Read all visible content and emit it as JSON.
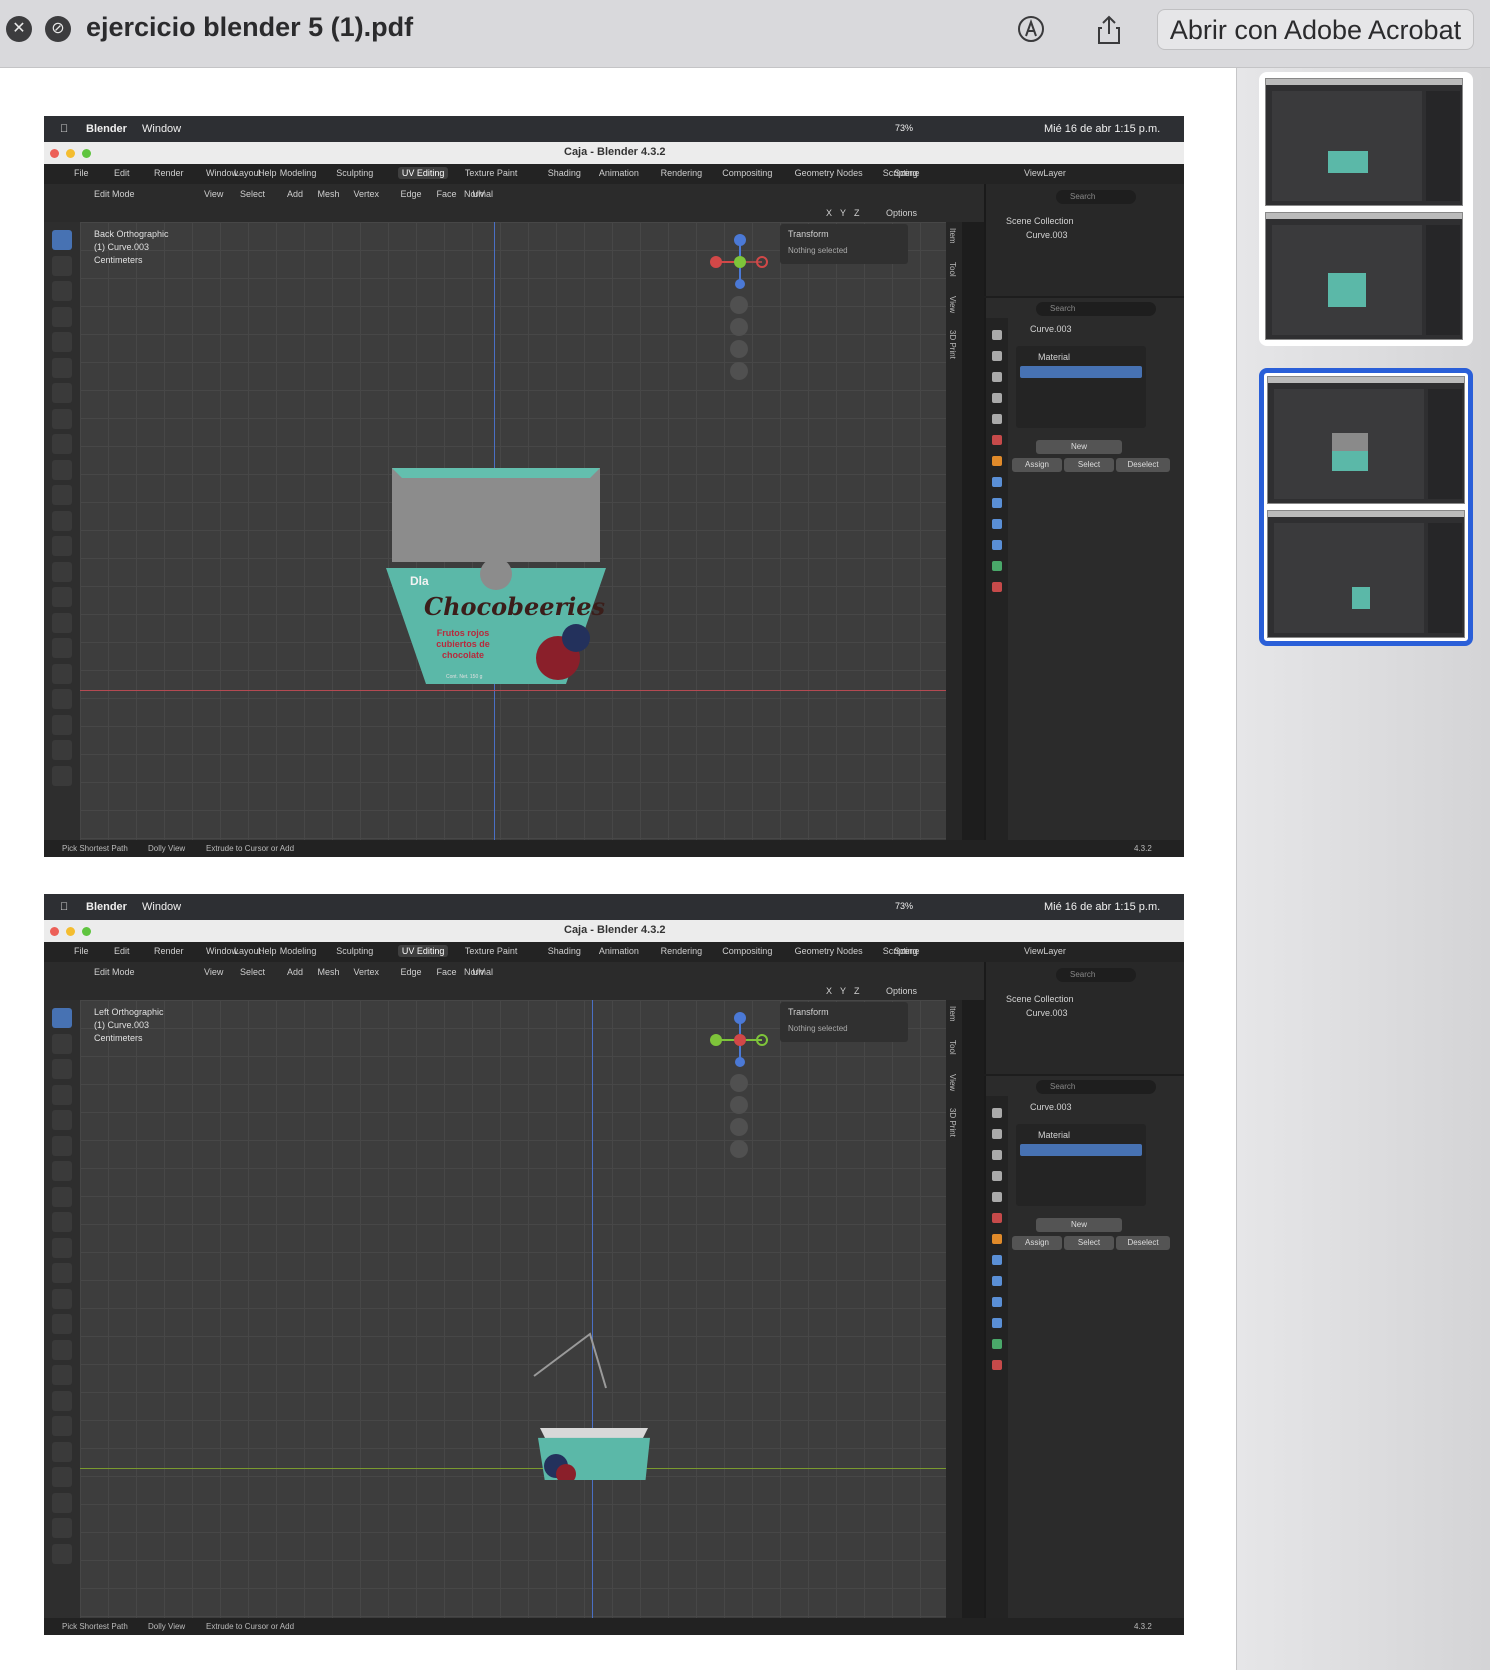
{
  "quicklook": {
    "title": "ejercicio blender 5 (1).pdf",
    "open_button": "Abrir con Adobe Acrobat",
    "close_icon": "close-icon",
    "markup_icon": "markup-icon",
    "share_icon": "share-icon"
  },
  "shots": [
    {
      "mac": {
        "app": "Blender",
        "menu": "Window",
        "battery": "73%",
        "datetime": "Mié 16 de abr  1:15 p.m."
      },
      "window_title": "Caja - Blender 4.3.2",
      "menus": [
        "File",
        "Edit",
        "Render",
        "Window",
        "Help"
      ],
      "workspaces": [
        "Layout",
        "Modeling",
        "Sculpting",
        "UV Editing",
        "Texture Paint",
        "Shading",
        "Animation",
        "Rendering",
        "Compositing",
        "Geometry Nodes",
        "Scripting"
      ],
      "active_workspace": "UV Editing",
      "scene": "Scene",
      "view_layer": "ViewLayer",
      "header": {
        "mode": "Edit Mode",
        "items": [
          "View",
          "Select",
          "Add",
          "Mesh",
          "Vertex",
          "Edge",
          "Face",
          "UV"
        ],
        "orientation": "Normal",
        "options": "Options",
        "axes": [
          "X",
          "Y",
          "Z"
        ]
      },
      "view_info": {
        "view": "Back Orthographic",
        "object": "(1) Curve.003",
        "units": "Centimeters"
      },
      "npanel": {
        "section": "Transform",
        "text": "Nothing selected"
      },
      "side_tabs": [
        "Item",
        "Tool",
        "View",
        "3D Print"
      ],
      "outliner": {
        "search": "Search",
        "collection": "Scene Collection",
        "object": "Curve.003"
      },
      "properties": {
        "search": "Search",
        "object": "Curve.003",
        "slot": "Material",
        "new": "New",
        "assign": "Assign",
        "select": "Select",
        "deselect": "Deselect"
      },
      "status": {
        "a": "Pick Shortest Path",
        "b": "Dolly View",
        "c": "Extrude to Cursor or Add",
        "version": "4.3.2"
      },
      "box_text": {
        "brand": "Dla",
        "name": "Chocobeeries",
        "desc": "Frutos rojos cubiertos de chocolate",
        "net": "Cont. Net. 150 g"
      }
    },
    {
      "mac": {
        "app": "Blender",
        "menu": "Window",
        "battery": "73%",
        "datetime": "Mié 16 de abr  1:15 p.m."
      },
      "window_title": "Caja - Blender 4.3.2",
      "menus": [
        "File",
        "Edit",
        "Render",
        "Window",
        "Help"
      ],
      "workspaces": [
        "Layout",
        "Modeling",
        "Sculpting",
        "UV Editing",
        "Texture Paint",
        "Shading",
        "Animation",
        "Rendering",
        "Compositing",
        "Geometry Nodes",
        "Scripting"
      ],
      "active_workspace": "UV Editing",
      "scene": "Scene",
      "view_layer": "ViewLayer",
      "header": {
        "mode": "Edit Mode",
        "items": [
          "View",
          "Select",
          "Add",
          "Mesh",
          "Vertex",
          "Edge",
          "Face",
          "UV"
        ],
        "orientation": "Normal",
        "options": "Options",
        "axes": [
          "X",
          "Y",
          "Z"
        ]
      },
      "view_info": {
        "view": "Left Orthographic",
        "object": "(1) Curve.003",
        "units": "Centimeters"
      },
      "npanel": {
        "section": "Transform",
        "text": "Nothing selected"
      },
      "side_tabs": [
        "Item",
        "Tool",
        "View",
        "3D Print"
      ],
      "outliner": {
        "search": "Search",
        "collection": "Scene Collection",
        "object": "Curve.003"
      },
      "properties": {
        "search": "Search",
        "object": "Curve.003",
        "slot": "Material",
        "new": "New",
        "assign": "Assign",
        "select": "Select",
        "deselect": "Deselect"
      },
      "status": {
        "a": "Pick Shortest Path",
        "b": "Dolly View",
        "c": "Extrude to Cursor or Add",
        "version": "4.3.2"
      }
    }
  ],
  "colors": {
    "accent": "#2a5fd8",
    "box_teal": "#5bb8a8",
    "blender_blue": "#4772b3"
  }
}
